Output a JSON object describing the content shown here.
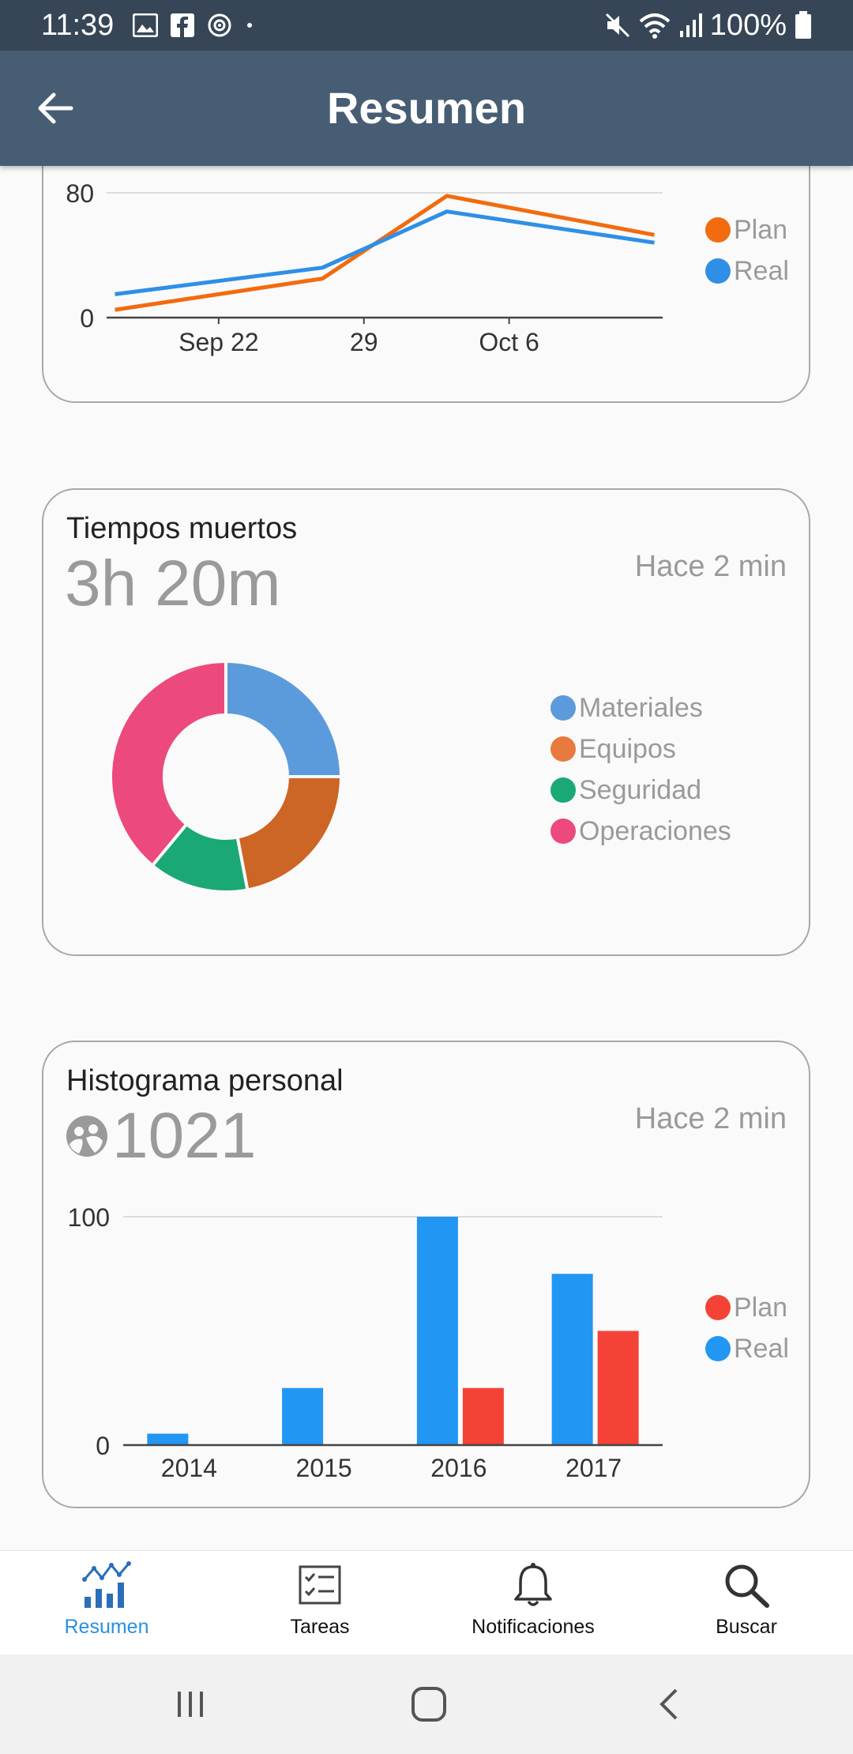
{
  "status_bar": {
    "time": "11:39",
    "battery": "100%"
  },
  "app_bar": {
    "title": "Resumen"
  },
  "line_card": {
    "legend": [
      {
        "label": "Plan",
        "color": "#f26b0f"
      },
      {
        "label": "Real",
        "color": "#2f8fe6"
      }
    ]
  },
  "downtime_card": {
    "title": "Tiempos muertos",
    "value": "3h 20m",
    "updated": "Hace 2 min",
    "legend": [
      {
        "label": "Materiales",
        "color": "#5b9bdc"
      },
      {
        "label": "Equipos",
        "color": "#e8793f"
      },
      {
        "label": "Seguridad",
        "color": "#1aa874"
      },
      {
        "label": "Operaciones",
        "color": "#ec4a7c"
      }
    ]
  },
  "histogram_card": {
    "title": "Histograma personal",
    "value": "1021",
    "updated": "Hace 2 min",
    "legend": [
      {
        "label": "Plan",
        "color": "#f44336"
      },
      {
        "label": "Real",
        "color": "#2196f3"
      }
    ]
  },
  "bottom_nav": {
    "items": [
      {
        "label": "Resumen",
        "icon": "bar-chart-icon",
        "active": true
      },
      {
        "label": "Tareas",
        "icon": "checklist-icon",
        "active": false
      },
      {
        "label": "Notificaciones",
        "icon": "bell-icon",
        "active": false
      },
      {
        "label": "Buscar",
        "icon": "search-icon",
        "active": false
      }
    ]
  },
  "chart_data": [
    {
      "type": "line",
      "x_ticks": [
        "Sep 22",
        "29",
        "Oct 6"
      ],
      "x": [
        "Sep 17",
        "Sep 27",
        "Oct 3",
        "Oct 13"
      ],
      "ylim": [
        0,
        80
      ],
      "y_ticks": [
        "0",
        "80"
      ],
      "grid": true,
      "legend_position": "right",
      "series": [
        {
          "name": "Plan",
          "color": "#f26b0f",
          "values": [
            5,
            25,
            78,
            53
          ]
        },
        {
          "name": "Real",
          "color": "#2f8fe6",
          "values": [
            15,
            32,
            68,
            48
          ]
        }
      ]
    },
    {
      "type": "pie",
      "donut": true,
      "slices": [
        {
          "label": "Materiales",
          "value": 25,
          "color": "#5b9bdc"
        },
        {
          "label": "Equipos",
          "value": 22,
          "color": "#cd6525"
        },
        {
          "label": "Seguridad",
          "value": 14,
          "color": "#1aa874"
        },
        {
          "label": "Operaciones",
          "value": 39,
          "color": "#ec4a7c"
        }
      ],
      "legend_position": "right"
    },
    {
      "type": "bar",
      "categories": [
        "2014",
        "2015",
        "2016",
        "2017"
      ],
      "ylim": [
        0,
        100
      ],
      "y_ticks": [
        "0",
        "100"
      ],
      "grid": true,
      "legend_position": "right",
      "series": [
        {
          "name": "Real",
          "color": "#2196f3",
          "values": [
            5,
            25,
            100,
            75
          ]
        },
        {
          "name": "Plan",
          "color": "#f44336",
          "values": [
            0,
            0,
            25,
            50
          ]
        }
      ]
    }
  ]
}
